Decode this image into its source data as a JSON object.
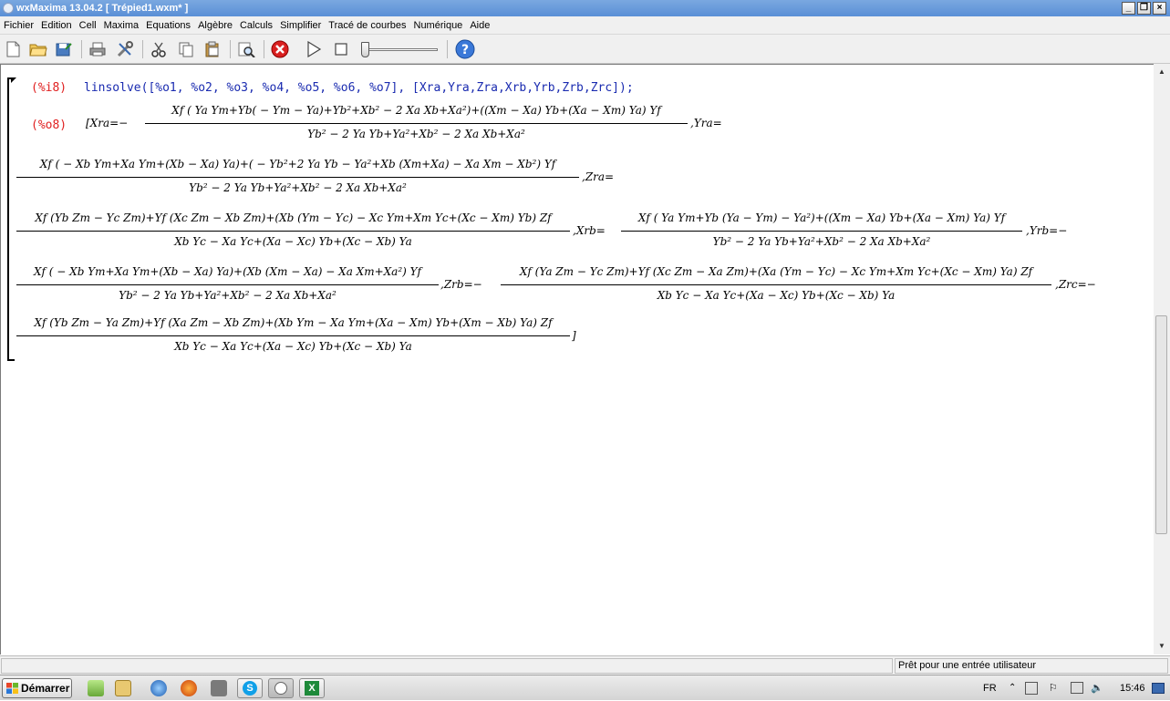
{
  "window": {
    "title": "wxMaxima 13.04.2 [ Trépied1.wxm* ]"
  },
  "menu": [
    "Fichier",
    "Edition",
    "Cell",
    "Maxima",
    "Equations",
    "Algèbre",
    "Calculs",
    "Simplifier",
    "Tracé de courbes",
    "Numérique",
    "Aide"
  ],
  "toolbar_icons": [
    "new-document",
    "open-folder",
    "save",
    "print",
    "preferences",
    "cut",
    "copy",
    "paste",
    "find",
    "interrupt",
    "play",
    "stop",
    "slider",
    "help"
  ],
  "cell": {
    "input_label": "(%i8)",
    "input": "linsolve([%o1, %o2, %o3, %o4, %o5, %o6, %o7], [Xra,Yra,Zra,Xrb,Yrb,Zrb,Zrc]);",
    "output_label": "(%o8)"
  },
  "output": {
    "open": "[Xra=−",
    "f1_num": "Xf ( Ya Ym+Yb( − Ym − Ya)+Yb²+Xb² − 2 Xa Xb+Xa²)+((Xm − Xa) Yb+(Xa − Xm) Ya) Yf",
    "f1_den": "Yb² − 2 Ya Yb+Ya²+Xb² − 2 Xa Xb+Xa²",
    "after_f1": ",Yra=",
    "f2_num": "Xf ( − Xb Ym+Xa Ym+(Xb − Xa) Ya)+( − Yb²+2 Ya Yb − Ya²+Xb (Xm+Xa) − Xa Xm − Xb²) Yf",
    "f2_den": "Yb² − 2 Ya Yb+Ya²+Xb² − 2 Xa Xb+Xa²",
    "after_f2": ",Zra=",
    "f3_num": "Xf (Yb Zm − Yc Zm)+Yf (Xc Zm − Xb Zm)+(Xb (Ym − Yc) − Xc Ym+Xm Yc+(Xc − Xm) Yb) Zf",
    "f3_den": "Xb Yc − Xa Yc+(Xa − Xc) Yb+(Xc − Xb) Ya",
    "after_f3": ",Xrb=",
    "f4_num": "Xf ( Ya Ym+Yb (Ya − Ym) − Ya²)+((Xm − Xa) Yb+(Xa − Xm) Ya) Yf",
    "f4_den": "Yb² − 2 Ya Yb+Ya²+Xb² − 2 Xa Xb+Xa²",
    "after_f4": ",Yrb=−",
    "f5_num": "Xf ( − Xb Ym+Xa Ym+(Xb − Xa) Ya)+(Xb (Xm − Xa) − Xa Xm+Xa²) Yf",
    "f5_den": "Yb² − 2 Ya Yb+Ya²+Xb² − 2 Xa Xb+Xa²",
    "after_f5": ",Zrb=−",
    "f6_num": "Xf (Ya Zm − Yc Zm)+Yf (Xc Zm − Xa Zm)+(Xa (Ym − Yc) − Xc Ym+Xm Yc+(Xc − Xm) Ya) Zf",
    "f6_den": "Xb Yc − Xa Yc+(Xa − Xc) Yb+(Xc − Xb) Ya",
    "after_f6": ",Zrc=−",
    "f7_num": "Xf (Yb Zm − Ya Zm)+Yf (Xa Zm − Xb Zm)+(Xb Ym − Xa Ym+(Xa − Xm) Yb+(Xm − Xb) Ya) Zf",
    "f7_den": "Xb Yc − Xa Yc+(Xa − Xc) Yb+(Xc − Xb) Ya",
    "close": "]"
  },
  "status": {
    "message": "Prêt pour une entrée utilisateur"
  },
  "taskbar": {
    "start": "Démarrer",
    "lang": "FR",
    "clock": "15:46"
  },
  "colors": {
    "input_label": "#e02020",
    "input_text": "#1a2bb0",
    "title_bar": "#6a9ad8"
  }
}
